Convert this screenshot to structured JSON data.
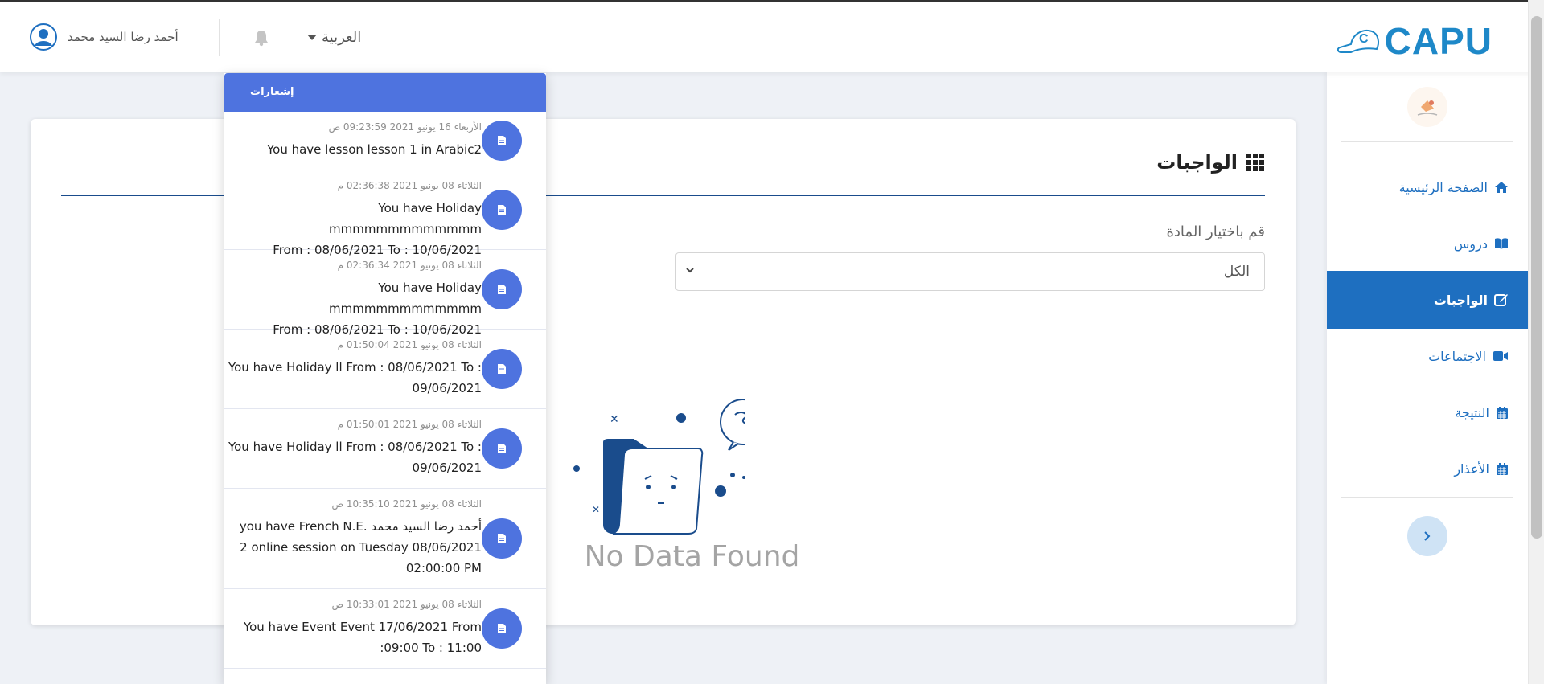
{
  "topbar": {
    "user_name": "أحمد رضا السيد محمد",
    "language": "العربية",
    "logo_text": "CAPU"
  },
  "sidebar": {
    "items": [
      {
        "label": "الصفحة الرئيسية",
        "icon": "home-icon",
        "active": false
      },
      {
        "label": "دروس",
        "icon": "book-icon",
        "active": false
      },
      {
        "label": "الواجبات",
        "icon": "edit-icon",
        "active": true
      },
      {
        "label": "الاجتماعات",
        "icon": "video-icon",
        "active": false
      },
      {
        "label": "النتيجة",
        "icon": "calendar-icon",
        "active": false
      },
      {
        "label": "الأعذار",
        "icon": "calendar-icon",
        "active": false
      }
    ]
  },
  "main": {
    "title": "الواجبات",
    "subject_label": "قم باختيار المادة",
    "subject_value": "الكل",
    "empty_text": "No Data Found"
  },
  "notifications": {
    "header": "إشعارات",
    "items": [
      {
        "date": "الأربعاء 16 يونيو 2021 09:23:59 ص",
        "lines": [
          "You have lesson lesson 1 in Arabic2"
        ]
      },
      {
        "date": "الثلاثاء 08 يونيو 2021 02:36:38 م",
        "lines": [
          "You have Holiday mmmmmmmmmmmmm",
          "From : 08/06/2021 To : 10/06/2021"
        ]
      },
      {
        "date": "الثلاثاء 08 يونيو 2021 02:36:34 م",
        "lines": [
          "You have Holiday mmmmmmmmmmmmm",
          "From : 08/06/2021 To : 10/06/2021"
        ]
      },
      {
        "date": "الثلاثاء 08 يونيو 2021 01:50:04 م",
        "lines": [
          "You have Holiday ll From : 08/06/2021 To :",
          "09/06/2021"
        ]
      },
      {
        "date": "الثلاثاء 08 يونيو 2021 01:50:01 م",
        "lines": [
          "You have Holiday ll From : 08/06/2021 To :",
          "09/06/2021"
        ]
      },
      {
        "date": "الثلاثاء 08 يونيو 2021 10:35:10 ص",
        "lines": [
          "you have French N.E. أحمد رضا السيد محمد",
          "2 online session on Tuesday 08/06/2021",
          "02:00:00 PM"
        ]
      },
      {
        "date": "الثلاثاء 08 يونيو 2021 10:33:01 ص",
        "lines": [
          "You have Event Event 17/06/2021 From",
          ":09:00 To : 11:00"
        ]
      }
    ]
  },
  "colors": {
    "primary": "#1e6fc0",
    "notif_blue": "#4e73df",
    "logo_blue": "#1e88c8",
    "navy_rule": "#1a4c8c"
  }
}
